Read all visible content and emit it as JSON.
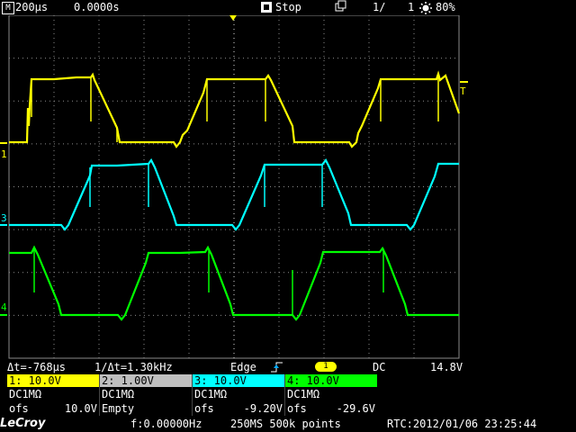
{
  "topbar": {
    "mode_icon": "M",
    "timebase": "200µs",
    "delay": "0.0000s",
    "run_state": "Stop",
    "acq_count_a": "1/",
    "acq_count_b": "1",
    "brightness": "80%",
    "icons": [
      "stop-icon",
      "copy-icon",
      "brightness-icon"
    ]
  },
  "markers": {
    "ch1": "1",
    "ch3": "3",
    "ch4": "4",
    "trig_level": "T"
  },
  "measurements": {
    "delta_t": "Δt=-768µs",
    "inv_delta_t": "1/Δt=1.30kHz",
    "trigger_type": "Edge",
    "trigger_source": "1",
    "coupling": "DC",
    "trigger_level": "14.8V"
  },
  "channels": [
    {
      "header": "1: 10.0V",
      "coupling": "DC1MΩ",
      "ofs_label": "ofs",
      "ofs_value": "10.0V",
      "color": "#ffff00"
    },
    {
      "header": "2: 1.00V",
      "coupling": "DC1MΩ",
      "ofs_label": "Empty",
      "ofs_value": "",
      "color": "#bfbfbf"
    },
    {
      "header": "3: 10.0V",
      "coupling": "DC1MΩ",
      "ofs_label": "ofs",
      "ofs_value": "-9.20V",
      "color": "#00ffff"
    },
    {
      "header": "4: 10.0V",
      "coupling": "DC1MΩ",
      "ofs_label": "ofs",
      "ofs_value": "-29.6V",
      "color": "#00ff00"
    }
  ],
  "bottombar": {
    "brand": "LeCroy",
    "frequency": "f:0.00000Hz",
    "sample_info": "250MS 500k points",
    "rtc": "RTC:2012/01/06 23:25:44"
  },
  "colors": {
    "ch1": "#ffff00",
    "ch3": "#00ffff",
    "ch4": "#00ff00",
    "grid": "#8a8a8a",
    "background": "#000000"
  }
}
